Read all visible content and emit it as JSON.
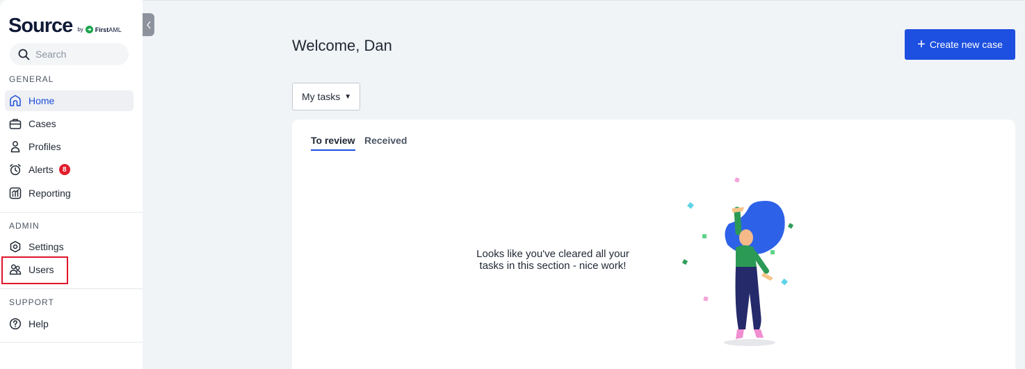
{
  "sidebar": {
    "logo": {
      "word": "Source",
      "by": "by",
      "brand_bold": "First",
      "brand_light": "AML"
    },
    "search": {
      "placeholder": "Search"
    },
    "sections": {
      "general": "GENERAL",
      "admin": "ADMIN",
      "support": "SUPPORT"
    },
    "items": {
      "home": "Home",
      "cases": "Cases",
      "profiles": "Profiles",
      "alerts": "Alerts",
      "alerts_count": "8",
      "reporting": "Reporting",
      "settings": "Settings",
      "users": "Users",
      "help": "Help"
    }
  },
  "main": {
    "welcome": "Welcome, Dan",
    "create_button": "Create new case",
    "tasks_dropdown": "My tasks",
    "tabs": {
      "to_review": "To review",
      "received": "Received"
    },
    "empty_line1": "Looks like you've cleared all your",
    "empty_line2": "tasks in this section - nice work!"
  },
  "colors": {
    "accent": "#1d4fe0",
    "alert_badge": "#e11d2c",
    "highlight": "#e0142b"
  }
}
